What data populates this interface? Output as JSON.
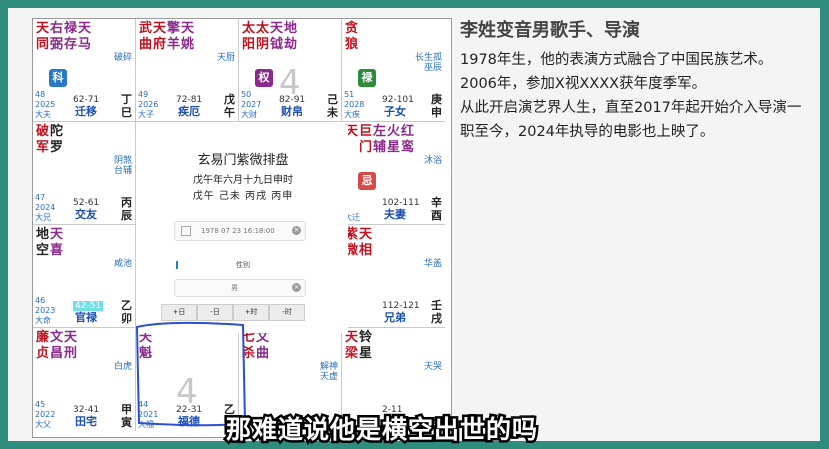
{
  "chart": {
    "title": "玄易门紫微排盘",
    "date_line": "戊午年六月十九日申时",
    "ganzhi_line": "戊午 己未 丙戌 丙申",
    "birth_input_value": "1978 07 23 16:18:00",
    "gender_label": "性别",
    "gender_value": "男",
    "buttons": [
      "+日",
      "-日",
      "+时",
      "-时"
    ],
    "big_numbers": [
      "4",
      "4"
    ],
    "cells": [
      {
        "stars": [
          "天同",
          "右弼",
          "禄存",
          "天马"
        ],
        "side": "破碎",
        "badge": "科",
        "ages": "62-71",
        "palace": "迁移",
        "year": "48",
        "year2": "2025",
        "stem": "大夫",
        "branch": "丁巳"
      },
      {
        "stars": [
          "武曲",
          "天府",
          "擎羊",
          "天姚"
        ],
        "side": "天厨",
        "ages": "72-81",
        "palace": "疾厄",
        "year": "49",
        "year2": "2026",
        "stem": "大子",
        "branch": "戊午"
      },
      {
        "stars": [
          "太阳",
          "太阴",
          "天钺",
          "地劫"
        ],
        "side": "",
        "badge": "权",
        "ages": "82-91",
        "palace": "财帛",
        "year": "50",
        "year2": "2027",
        "stem": "大财",
        "branch": "己未"
      },
      {
        "stars": [
          "贪狼"
        ],
        "side": "长生孤巫辰",
        "badge": "禄",
        "ages": "92-101",
        "palace": "子女",
        "year": "51",
        "year2": "2028",
        "stem": "大疾",
        "branch": "庚申"
      },
      {
        "stars": [
          "破军",
          "陀罗"
        ],
        "side": "阴煞台辅",
        "ages": "52-61",
        "palace": "交友",
        "year": "47",
        "year2": "2024",
        "stem": "大兄",
        "branch": "丙辰"
      },
      {
        "stars": [
          "天",
          "巨门",
          "左辅",
          "火星",
          "红鸾"
        ],
        "side": "沐浴",
        "badge": "忌",
        "ages": "102-111",
        "palace": "夫妻",
        "year": "",
        "year2": "",
        "stem": "大迁",
        "branch": "辛酉"
      },
      {
        "stars": [
          "地空",
          "天喜"
        ],
        "side": "咸池",
        "ages": "42-51",
        "palace": "官禄",
        "year": "46",
        "year2": "2023",
        "stem": "大命",
        "branch": "乙卯"
      },
      {
        "stars": [
          "紫微",
          "天相"
        ],
        "side": "华盖",
        "ages": "112-121",
        "palace": "兄弟",
        "year": "",
        "year2": "",
        "stem": "",
        "branch": "壬戌"
      },
      {
        "stars": [
          "廉贞",
          "文昌",
          "天刑"
        ],
        "side": "白虎",
        "ages": "32-41",
        "palace": "田宅",
        "year": "45",
        "year2": "2022",
        "stem": "大父",
        "branch": "甲寅"
      },
      {
        "stars": [
          "天魁"
        ],
        "side": "",
        "ages": "22-31",
        "palace": "福德",
        "year": "44",
        "year2": "2021",
        "stem": "大福",
        "branch": "乙丑"
      },
      {
        "stars": [
          "七杀",
          "文曲"
        ],
        "side": "解神天虚",
        "ages": "",
        "palace": "",
        "year": "43",
        "year2": "",
        "stem": "",
        "branch": ""
      },
      {
        "stars": [
          "天梁",
          "铃星"
        ],
        "side": "天哭",
        "ages": "2-11",
        "palace": "",
        "year": "",
        "year2": "",
        "stem": "",
        "branch": "癸"
      }
    ]
  },
  "article": {
    "title": "李姓变音男歌手、导演",
    "paragraphs": [
      "1978年生，他的表演方式融合了中国民族艺术。",
      "2006年，参加X视XXXX获年度季军。",
      "从此开启演艺界人生，直至2017年起开始介入导演一职至今，2024年执导的电影也上映了。"
    ]
  },
  "subtitle": "那难道说他是横空出世的吗",
  "colors": {
    "background": "#2f8d7d",
    "badge_ke": "#2a78c8",
    "badge_quan": "#8a2a8a",
    "badge_lu": "#2e8b3a",
    "badge_ji": "#d84a4a"
  }
}
